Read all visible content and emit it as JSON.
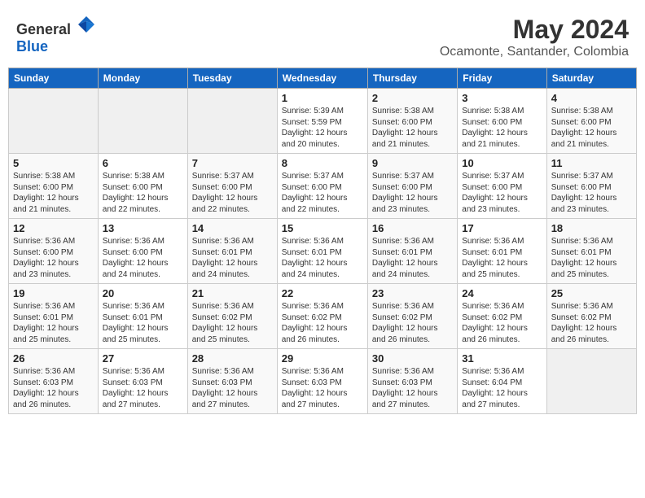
{
  "header": {
    "logo": {
      "text_general": "General",
      "text_blue": "Blue"
    },
    "month_year": "May 2024",
    "location": "Ocamonte, Santander, Colombia"
  },
  "weekdays": [
    "Sunday",
    "Monday",
    "Tuesday",
    "Wednesday",
    "Thursday",
    "Friday",
    "Saturday"
  ],
  "weeks": [
    [
      {
        "day": "",
        "info": ""
      },
      {
        "day": "",
        "info": ""
      },
      {
        "day": "",
        "info": ""
      },
      {
        "day": "1",
        "info": "Sunrise: 5:39 AM\nSunset: 5:59 PM\nDaylight: 12 hours\nand 20 minutes."
      },
      {
        "day": "2",
        "info": "Sunrise: 5:38 AM\nSunset: 6:00 PM\nDaylight: 12 hours\nand 21 minutes."
      },
      {
        "day": "3",
        "info": "Sunrise: 5:38 AM\nSunset: 6:00 PM\nDaylight: 12 hours\nand 21 minutes."
      },
      {
        "day": "4",
        "info": "Sunrise: 5:38 AM\nSunset: 6:00 PM\nDaylight: 12 hours\nand 21 minutes."
      }
    ],
    [
      {
        "day": "5",
        "info": "Sunrise: 5:38 AM\nSunset: 6:00 PM\nDaylight: 12 hours\nand 21 minutes."
      },
      {
        "day": "6",
        "info": "Sunrise: 5:38 AM\nSunset: 6:00 PM\nDaylight: 12 hours\nand 22 minutes."
      },
      {
        "day": "7",
        "info": "Sunrise: 5:37 AM\nSunset: 6:00 PM\nDaylight: 12 hours\nand 22 minutes."
      },
      {
        "day": "8",
        "info": "Sunrise: 5:37 AM\nSunset: 6:00 PM\nDaylight: 12 hours\nand 22 minutes."
      },
      {
        "day": "9",
        "info": "Sunrise: 5:37 AM\nSunset: 6:00 PM\nDaylight: 12 hours\nand 23 minutes."
      },
      {
        "day": "10",
        "info": "Sunrise: 5:37 AM\nSunset: 6:00 PM\nDaylight: 12 hours\nand 23 minutes."
      },
      {
        "day": "11",
        "info": "Sunrise: 5:37 AM\nSunset: 6:00 PM\nDaylight: 12 hours\nand 23 minutes."
      }
    ],
    [
      {
        "day": "12",
        "info": "Sunrise: 5:36 AM\nSunset: 6:00 PM\nDaylight: 12 hours\nand 23 minutes."
      },
      {
        "day": "13",
        "info": "Sunrise: 5:36 AM\nSunset: 6:00 PM\nDaylight: 12 hours\nand 24 minutes."
      },
      {
        "day": "14",
        "info": "Sunrise: 5:36 AM\nSunset: 6:01 PM\nDaylight: 12 hours\nand 24 minutes."
      },
      {
        "day": "15",
        "info": "Sunrise: 5:36 AM\nSunset: 6:01 PM\nDaylight: 12 hours\nand 24 minutes."
      },
      {
        "day": "16",
        "info": "Sunrise: 5:36 AM\nSunset: 6:01 PM\nDaylight: 12 hours\nand 24 minutes."
      },
      {
        "day": "17",
        "info": "Sunrise: 5:36 AM\nSunset: 6:01 PM\nDaylight: 12 hours\nand 25 minutes."
      },
      {
        "day": "18",
        "info": "Sunrise: 5:36 AM\nSunset: 6:01 PM\nDaylight: 12 hours\nand 25 minutes."
      }
    ],
    [
      {
        "day": "19",
        "info": "Sunrise: 5:36 AM\nSunset: 6:01 PM\nDaylight: 12 hours\nand 25 minutes."
      },
      {
        "day": "20",
        "info": "Sunrise: 5:36 AM\nSunset: 6:01 PM\nDaylight: 12 hours\nand 25 minutes."
      },
      {
        "day": "21",
        "info": "Sunrise: 5:36 AM\nSunset: 6:02 PM\nDaylight: 12 hours\nand 25 minutes."
      },
      {
        "day": "22",
        "info": "Sunrise: 5:36 AM\nSunset: 6:02 PM\nDaylight: 12 hours\nand 26 minutes."
      },
      {
        "day": "23",
        "info": "Sunrise: 5:36 AM\nSunset: 6:02 PM\nDaylight: 12 hours\nand 26 minutes."
      },
      {
        "day": "24",
        "info": "Sunrise: 5:36 AM\nSunset: 6:02 PM\nDaylight: 12 hours\nand 26 minutes."
      },
      {
        "day": "25",
        "info": "Sunrise: 5:36 AM\nSunset: 6:02 PM\nDaylight: 12 hours\nand 26 minutes."
      }
    ],
    [
      {
        "day": "26",
        "info": "Sunrise: 5:36 AM\nSunset: 6:03 PM\nDaylight: 12 hours\nand 26 minutes."
      },
      {
        "day": "27",
        "info": "Sunrise: 5:36 AM\nSunset: 6:03 PM\nDaylight: 12 hours\nand 27 minutes."
      },
      {
        "day": "28",
        "info": "Sunrise: 5:36 AM\nSunset: 6:03 PM\nDaylight: 12 hours\nand 27 minutes."
      },
      {
        "day": "29",
        "info": "Sunrise: 5:36 AM\nSunset: 6:03 PM\nDaylight: 12 hours\nand 27 minutes."
      },
      {
        "day": "30",
        "info": "Sunrise: 5:36 AM\nSunset: 6:03 PM\nDaylight: 12 hours\nand 27 minutes."
      },
      {
        "day": "31",
        "info": "Sunrise: 5:36 AM\nSunset: 6:04 PM\nDaylight: 12 hours\nand 27 minutes."
      },
      {
        "day": "",
        "info": ""
      }
    ]
  ]
}
